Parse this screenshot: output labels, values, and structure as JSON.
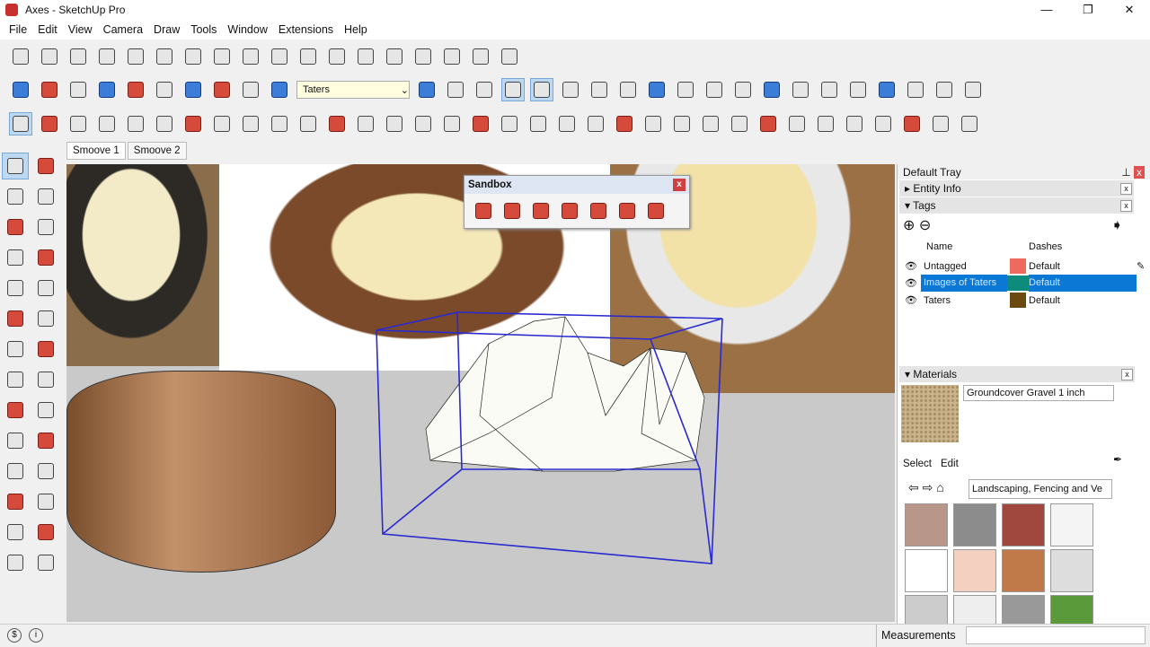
{
  "window": {
    "title": "Axes - SketchUp Pro",
    "min": "—",
    "restore": "❐",
    "close": "✕"
  },
  "menu": [
    "File",
    "Edit",
    "View",
    "Camera",
    "Draw",
    "Tools",
    "Window",
    "Extensions",
    "Help"
  ],
  "toolbar": {
    "tag_select": "Taters"
  },
  "scene_tabs": [
    "Smoove 1",
    "Smoove 2"
  ],
  "sandbox": {
    "title": "Sandbox",
    "close": "x"
  },
  "tray": {
    "title": "Default Tray",
    "pin": "⊥",
    "close": "x",
    "entity_info": "Entity Info",
    "tags": {
      "title": "Tags",
      "col_name": "Name",
      "col_dashes": "Dashes",
      "rows": [
        {
          "name": "Untagged",
          "color": "#ee6a5e",
          "dashes": "Default"
        },
        {
          "name": "Images of Taters",
          "color": "#0d8b7c",
          "dashes": "Default"
        },
        {
          "name": "Taters",
          "color": "#6b4a10",
          "dashes": "Default"
        }
      ]
    },
    "materials": {
      "title": "Materials",
      "name": "Groundcover Gravel 1 inch",
      "tab_select": "Select",
      "tab_edit": "Edit",
      "collection": "Landscaping, Fencing and Ve"
    }
  },
  "status": {
    "measurements": "Measurements"
  },
  "colors": {
    "selection": "#0b78d6",
    "bbox": "#2a2ad0"
  }
}
